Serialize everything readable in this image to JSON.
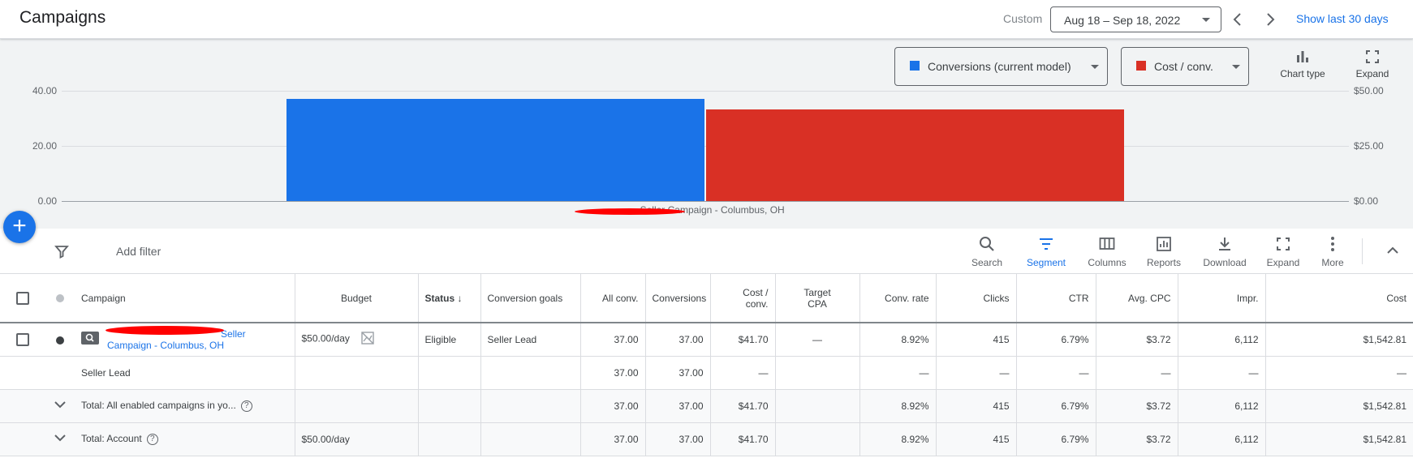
{
  "header": {
    "title": "Campaigns",
    "custom_label": "Custom",
    "date_range": "Aug 18 – Sep 18, 2022",
    "show_last_30": "Show last 30 days"
  },
  "chart_controls": {
    "metric1": "Conversions (current model)",
    "metric1_color": "#1a73e8",
    "metric2": "Cost / conv.",
    "metric2_color": "#d93025",
    "chart_type_label": "Chart type",
    "expand_label": "Expand"
  },
  "chart_data": {
    "type": "bar",
    "categories": [
      "Seller Campaign - Columbus, OH"
    ],
    "category_label": "- Seller Campaign - Columbus, OH",
    "series": [
      {
        "name": "Conversions (current model)",
        "values": [
          37.0
        ],
        "axis": "left",
        "color": "#1a73e8"
      },
      {
        "name": "Cost / conv.",
        "values": [
          41.7
        ],
        "axis": "right",
        "color": "#d93025"
      }
    ],
    "left_ticks": [
      "40.00",
      "20.00",
      "0.00"
    ],
    "right_ticks": [
      "$50.00",
      "$25.00",
      "$0.00"
    ],
    "ylim_left": [
      0,
      40
    ],
    "ylim_right": [
      0,
      50
    ]
  },
  "fab_label": "+",
  "toolbar": {
    "add_filter": "Add filter",
    "search": "Search",
    "segment": "Segment",
    "columns": "Columns",
    "reports": "Reports",
    "download": "Download",
    "expand": "Expand",
    "more": "More",
    "accent": "#1a73e8"
  },
  "table": {
    "headers": {
      "campaign": "Campaign",
      "budget": "Budget",
      "status": "Status",
      "conversion_goals": "Conversion goals",
      "all_conv": "All conv.",
      "conversions": "Conversions",
      "cost_conv_1": "Cost /",
      "cost_conv_2": "conv.",
      "target_cpa_1": "Target",
      "target_cpa_2": "CPA",
      "conv_rate": "Conv. rate",
      "clicks": "Clicks",
      "ctr": "CTR",
      "avg_cpc": "Avg. CPC",
      "impr": "Impr.",
      "cost": "Cost"
    },
    "campaign_row": {
      "name_part1": "Seller",
      "name_part2": "Campaign - Columbus, OH",
      "budget": "$50.00/day",
      "status": "Eligible",
      "conversion_goals": "Seller Lead",
      "all_conv": "37.00",
      "conversions": "37.00",
      "cost_conv": "$41.70",
      "target_cpa": "—",
      "conv_rate": "8.92%",
      "clicks": "415",
      "ctr": "6.79%",
      "avg_cpc": "$3.72",
      "impr": "6,112",
      "cost": "$1,542.81"
    },
    "goal_row": {
      "name": "Seller Lead",
      "all_conv": "37.00",
      "conversions": "37.00",
      "cost_conv": "—",
      "conv_rate": "—",
      "clicks": "—",
      "ctr": "—",
      "avg_cpc": "—",
      "impr": "—",
      "cost": "—"
    },
    "total_enabled_row": {
      "name": "Total: All enabled campaigns in yo...",
      "all_conv": "37.00",
      "conversions": "37.00",
      "cost_conv": "$41.70",
      "conv_rate": "8.92%",
      "clicks": "415",
      "ctr": "6.79%",
      "avg_cpc": "$3.72",
      "impr": "6,112",
      "cost": "$1,542.81"
    },
    "total_account_row": {
      "name": "Total: Account",
      "budget": "$50.00/day",
      "all_conv": "37.00",
      "conversions": "37.00",
      "cost_conv": "$41.70",
      "conv_rate": "8.92%",
      "clicks": "415",
      "ctr": "6.79%",
      "avg_cpc": "$3.72",
      "impr": "6,112",
      "cost": "$1,542.81"
    }
  }
}
